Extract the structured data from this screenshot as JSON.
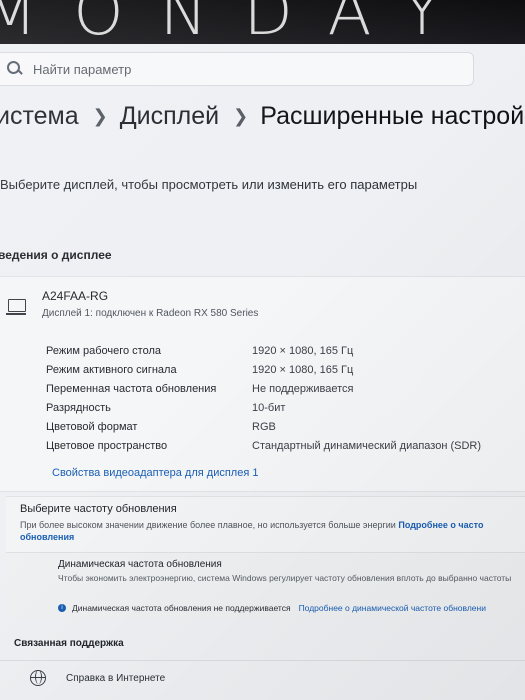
{
  "bezel": {
    "brand": "MONDAY"
  },
  "search": {
    "placeholder": "Найти параметр"
  },
  "breadcrumb": {
    "items": [
      "истема",
      "Дисплей",
      "Расширенные настрой"
    ]
  },
  "subtitle": "Выберите дисплей, чтобы просмотреть или изменить его параметры",
  "display_info": {
    "section_title": "ведения о дисплее",
    "name": "A24FAA-RG",
    "subtitle": "Дисплей 1: подключен к Radeon RX 580 Series",
    "properties": [
      {
        "key": "Режим рабочего стола",
        "value": "1920 × 1080, 165 Гц"
      },
      {
        "key": "Режим активного сигнала",
        "value": "1920 × 1080, 165 Гц"
      },
      {
        "key": "Переменная частота обновления",
        "value": "Не поддерживается"
      },
      {
        "key": "Разрядность",
        "value": "10-бит"
      },
      {
        "key": "Цветовой формат",
        "value": "RGB"
      },
      {
        "key": "Цветовое пространство",
        "value": "Стандартный динамический диапазон (SDR)"
      }
    ],
    "adapter_link": "Свойства видеоадаптера для дисплея 1"
  },
  "refresh": {
    "title": "Выберите частоту обновления",
    "desc_line1": "При более высоком значении движение более плавное, но используется больше энергии",
    "link_part1": "Подробнее о часто",
    "link_part2": "обновления"
  },
  "dynamic": {
    "title": "Динамическая частота обновления",
    "desc": "Чтобы экономить электроэнергию, система Windows регулирует частоту обновления вплоть до выбранно частоты",
    "note": "Динамическая частота обновления не поддерживается",
    "note_link": "Подробнее о динамической частоте обновлени",
    "info_icon": "info-icon"
  },
  "support": {
    "title": "Связанная поддержка",
    "help": "Справка в Интернете"
  }
}
